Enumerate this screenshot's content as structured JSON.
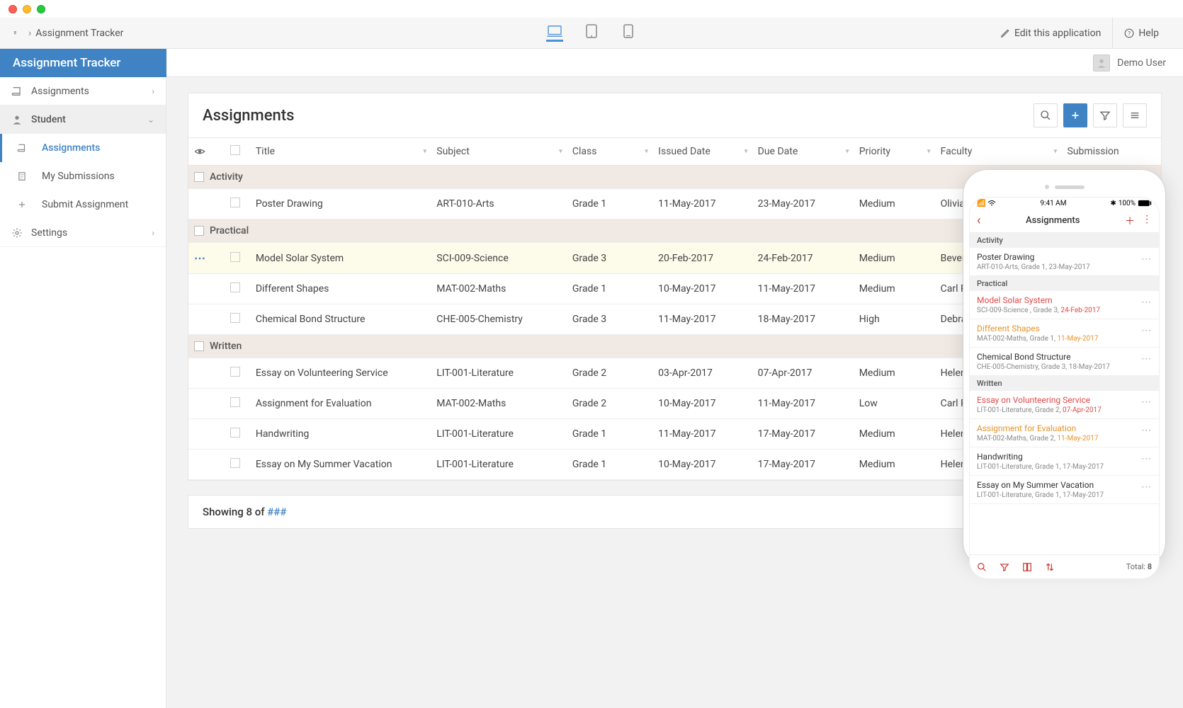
{
  "breadcrumb": {
    "app": "Assignment Tracker"
  },
  "top": {
    "edit": "Edit this application",
    "help": "Help"
  },
  "app_title": "Assignment Tracker",
  "user": {
    "name": "Demo User"
  },
  "sidebar": {
    "assignments": "Assignments",
    "student": "Student",
    "sub": {
      "assignments": "Assignments",
      "submissions": "My Submissions",
      "submit": "Submit Assignment"
    },
    "settings": "Settings"
  },
  "page": {
    "title": "Assignments"
  },
  "columns": {
    "title": "Title",
    "subject": "Subject",
    "class": "Class",
    "issued": "Issued Date",
    "due": "Due Date",
    "priority": "Priority",
    "faculty": "Faculty",
    "submission": "Submission"
  },
  "groups": {
    "activity": "Activity",
    "practical": "Practical",
    "written": "Written"
  },
  "rows": {
    "r0": {
      "title": "Poster Drawing",
      "subject": "ART-010-Arts",
      "class": "Grade 1",
      "issued": "11-May-2017",
      "due": "23-May-2017",
      "priority": "Medium",
      "faculty": "Olivia Baker"
    },
    "r1": {
      "title": "Model Solar System",
      "subject": "SCI-009-Science",
      "class": "Grade 3",
      "issued": "20-Feb-2017",
      "due": "24-Feb-2017",
      "priority": "Medium",
      "faculty": "Beverly C"
    },
    "r2": {
      "title": "Different Shapes",
      "subject": "MAT-002-Maths",
      "class": "Grade 1",
      "issued": "10-May-2017",
      "due": "11-May-2017",
      "priority": "Medium",
      "faculty": "Carl Rich"
    },
    "r3": {
      "title": "Chemical Bond Structure",
      "subject": "CHE-005-Chemistry",
      "class": "Grade 3",
      "issued": "11-May-2017",
      "due": "18-May-2017",
      "priority": "High",
      "faculty": "Debra Br"
    },
    "r4": {
      "title": "Essay on Volunteering Service",
      "subject": "LIT-001-Literature",
      "class": "Grade 2",
      "issued": "03-Apr-2017",
      "due": "07-Apr-2017",
      "priority": "Medium",
      "faculty": "Helen Sa"
    },
    "r5": {
      "title": "Assignment for Evaluation",
      "subject": "MAT-002-Maths",
      "class": "Grade 2",
      "issued": "10-May-2017",
      "due": "11-May-2017",
      "priority": "Low",
      "faculty": "Carl Rich"
    },
    "r6": {
      "title": "Handwriting",
      "subject": "LIT-001-Literature",
      "class": "Grade 1",
      "issued": "11-May-2017",
      "due": "17-May-2017",
      "priority": "Medium",
      "faculty": "Helen Sa"
    },
    "r7": {
      "title": "Essay on My Summer Vacation",
      "subject": "LIT-001-Literature",
      "class": "Grade 1",
      "issued": "10-May-2017",
      "due": "17-May-2017",
      "priority": "Medium",
      "faculty": "Helen Sa"
    }
  },
  "footer": {
    "showing": "Showing 8 of ",
    "hash": "###"
  },
  "mobile": {
    "time": "9:41 AM",
    "battery": "100%",
    "title": "Assignments",
    "sections": {
      "activity": "Activity",
      "practical": "Practical",
      "written": "Written"
    },
    "rows": {
      "m0": {
        "title": "Poster Drawing",
        "sub": "ART-010-Arts, Grade 1, 23-May-2017"
      },
      "m1": {
        "title": "Model Solar System",
        "sub_a": "SCI-009-Science , Grade 3,  ",
        "sub_b": "24-Feb-2017"
      },
      "m2": {
        "title": "Different Shapes",
        "sub_a": "MAT-002-Maths, Grade 1,  ",
        "sub_b": "11-May-2017"
      },
      "m3": {
        "title": "Chemical Bond Structure",
        "sub": "CHE-005-Chemistry, Grade 3, 18-May-2017"
      },
      "m4": {
        "title": "Essay on Volunteering Service",
        "sub_a": "LIT-001-Literature, Grade 2,  ",
        "sub_b": "07-Apr-2017"
      },
      "m5": {
        "title": "Assignment for Evaluation",
        "sub_a": "MAT-002-Maths, Grade 2,  ",
        "sub_b": "11-May-2017"
      },
      "m6": {
        "title": "Handwriting",
        "sub": "LIT-001-Literature, Grade 1, 17-May-2017"
      },
      "m7": {
        "title": "Essay on My Summer Vacation",
        "sub": "LIT-001-Literature, Grade 1, 17-May-2017"
      }
    },
    "total_label": "Total: ",
    "total_value": "8"
  }
}
